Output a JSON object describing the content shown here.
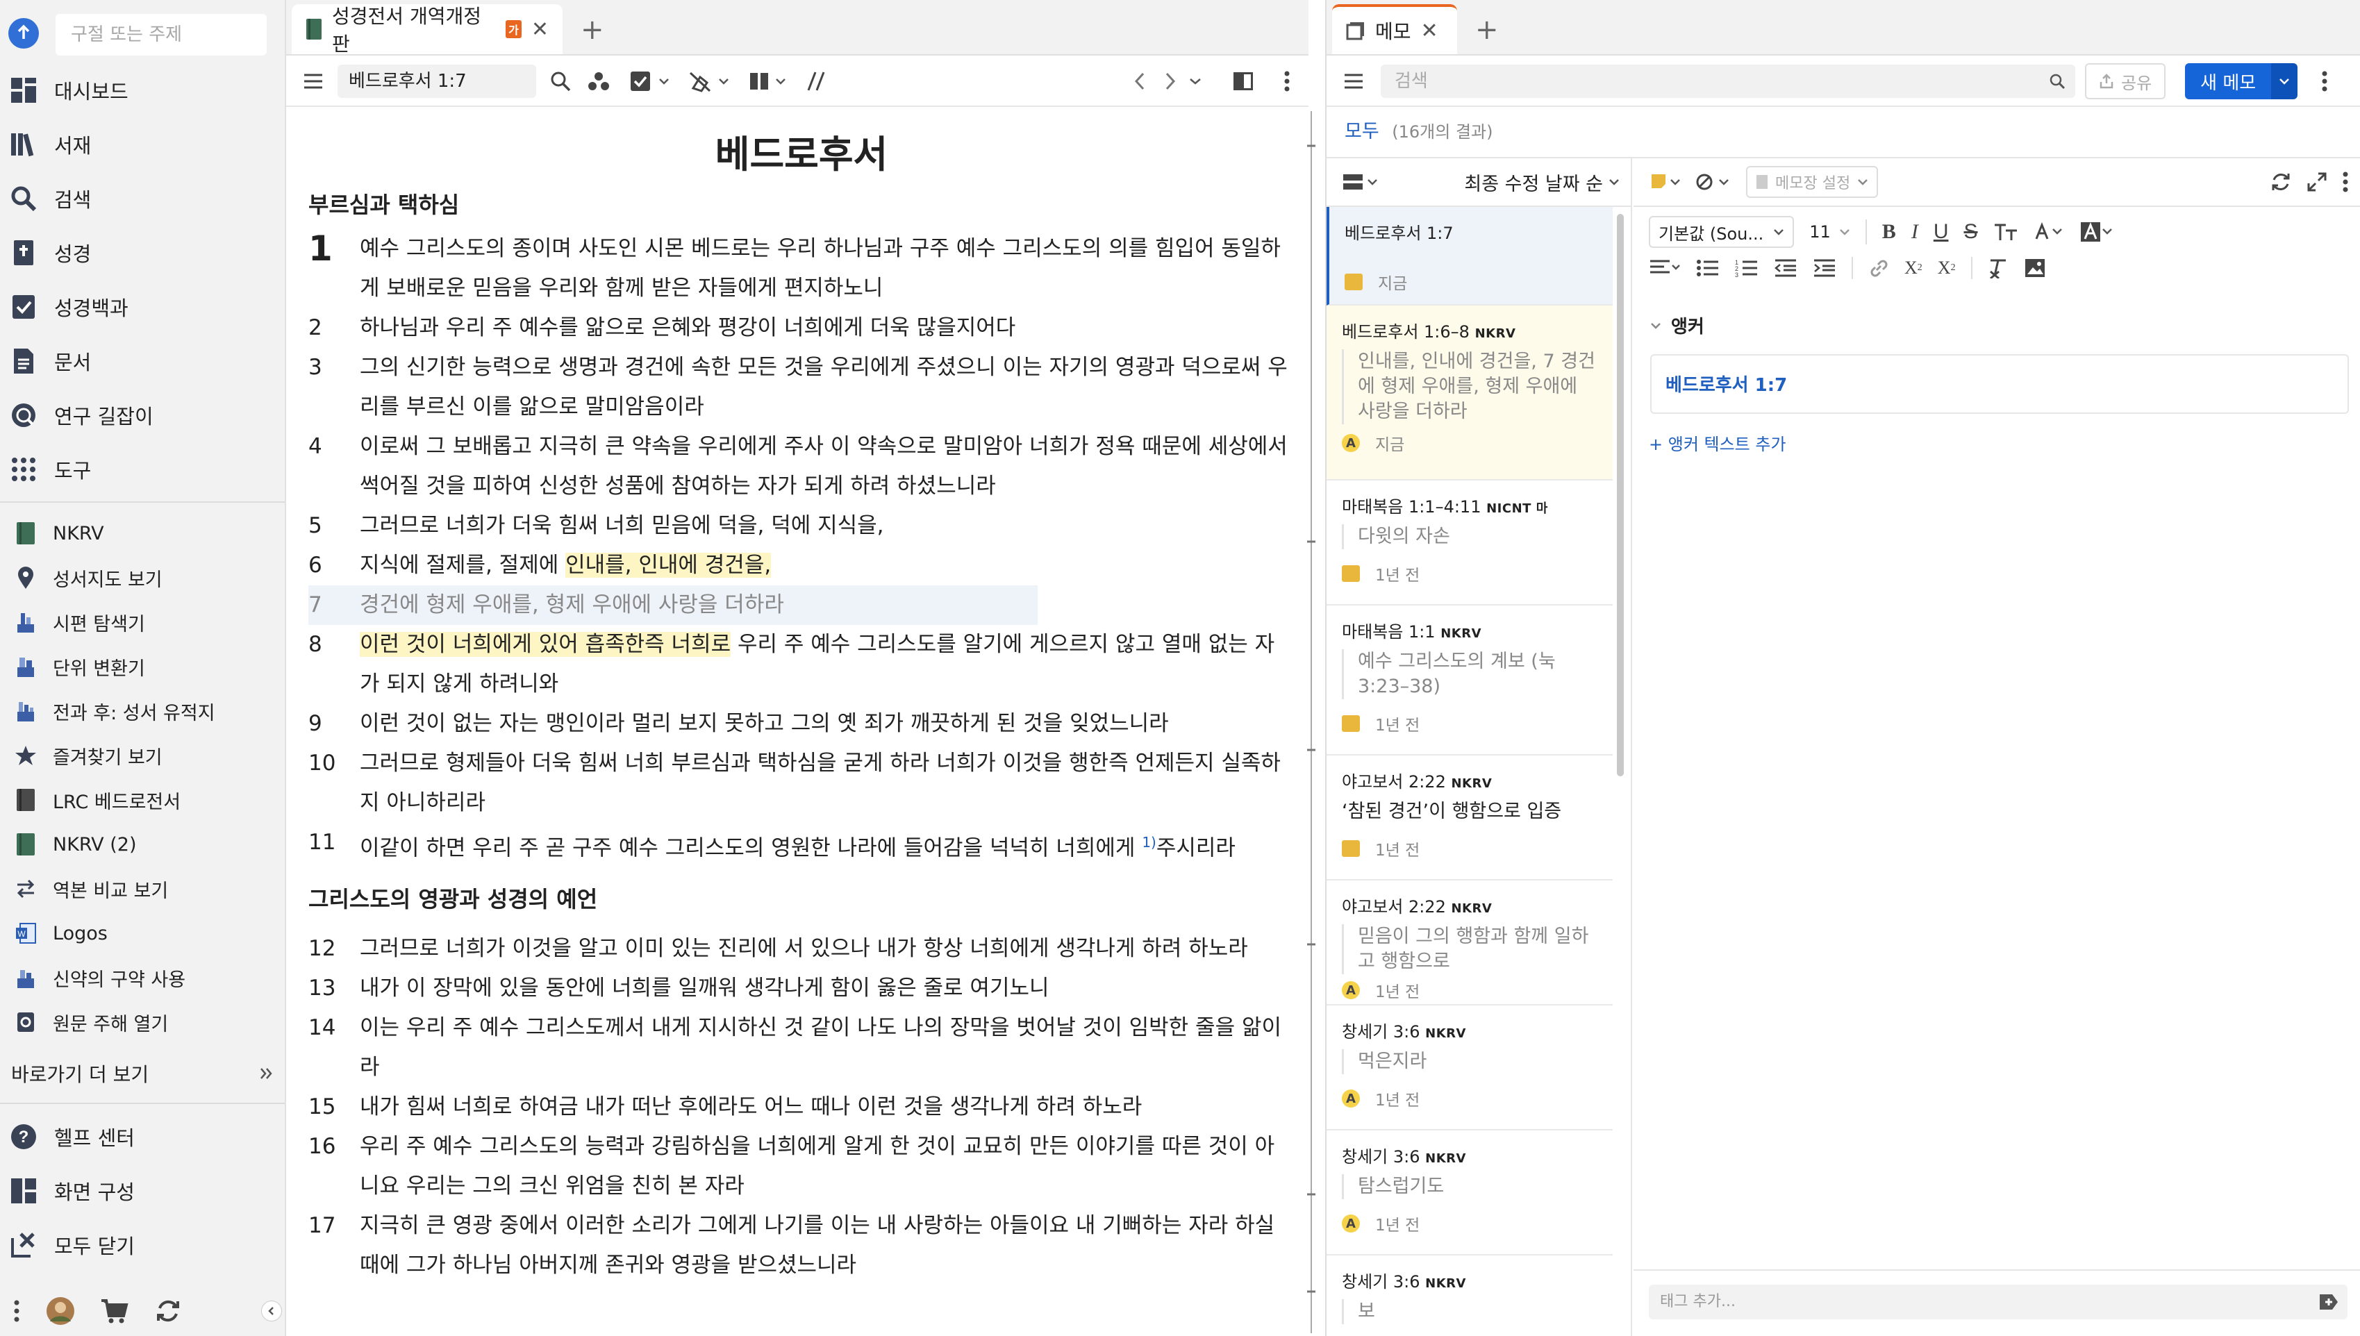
{
  "sidebar": {
    "search_placeholder": "구절 또는 주제",
    "main_items": [
      {
        "label": "대시보드",
        "icon": "dashboard-icon"
      },
      {
        "label": "서재",
        "icon": "library-icon"
      },
      {
        "label": "검색",
        "icon": "search-icon"
      },
      {
        "label": "성경",
        "icon": "bible-icon"
      },
      {
        "label": "성경백과",
        "icon": "factbook-icon"
      },
      {
        "label": "문서",
        "icon": "document-icon"
      },
      {
        "label": "연구 길잡이",
        "icon": "guide-icon"
      },
      {
        "label": "도구",
        "icon": "tools-icon"
      }
    ],
    "shortcuts": [
      {
        "label": "NKRV",
        "icon": "book-icon"
      },
      {
        "label": "성서지도 보기",
        "icon": "map-pin-icon"
      },
      {
        "label": "시편 탐색기",
        "icon": "psalm-icon"
      },
      {
        "label": "단위 변환기",
        "icon": "converter-icon"
      },
      {
        "label": "전과 후: 성서 유적지",
        "icon": "before-after-icon"
      },
      {
        "label": "즐겨찾기 보기",
        "icon": "star-icon"
      },
      {
        "label": "LRC 베드로전서",
        "icon": "book-icon"
      },
      {
        "label": "NKRV (2)",
        "icon": "book-icon"
      },
      {
        "label": "역본 비교 보기",
        "icon": "compare-icon"
      },
      {
        "label": "Logos",
        "icon": "word-icon"
      },
      {
        "label": "신약의 구약 사용",
        "icon": "ot-in-nt-icon"
      },
      {
        "label": "원문 주해 열기",
        "icon": "exegetical-icon"
      }
    ],
    "more_label": "바로가기 더 보기",
    "bottom_items": [
      {
        "label": "헬프 센터",
        "icon": "help-icon"
      },
      {
        "label": "화면 구성",
        "icon": "layout-icon"
      },
      {
        "label": "모두 닫기",
        "icon": "close-all-icon"
      }
    ]
  },
  "bible": {
    "tab_title": "성경전서 개역개정판",
    "tab_badge": "가",
    "reference": "베드로후서 1:7",
    "book_title": "베드로후서",
    "sections": [
      {
        "heading": "부르심과 택하심",
        "verses": [
          {
            "num": "1",
            "text": "예수 그리스도의 종이며 사도인 시몬 베드로는 우리 하나님과 구주 예수 그리스도의 의를 힘입어 동일하게 보배로운 믿음을 우리와 함께 받은 자들에게 편지하노니"
          },
          {
            "num": "2",
            "text": "하나님과 우리 주 예수를 앎으로 은혜와 평강이 너희에게 더욱 많을지어다"
          },
          {
            "num": "3",
            "text": "그의 신기한 능력으로 생명과 경건에 속한 모든 것을 우리에게 주셨으니 이는 자기의 영광과 덕으로써 우리를 부르신 이를 앎으로 말미암음이라"
          },
          {
            "num": "4",
            "text": "이로써 그 보배롭고 지극히 큰 약속을 우리에게 주사 이 약속으로 말미암아 너희가 정욕 때문에 세상에서 썩어질 것을 피하여 신성한 성품에 참여하는 자가 되게 하려 하셨느니라"
          },
          {
            "num": "5",
            "text": "그러므로 너희가 더욱 힘써 너희 믿음에 덕을, 덕에 지식을,"
          },
          {
            "num": "6",
            "pre": "지식에 절제를, 절제에 ",
            "hl": "인내를, 인내에 경건을,"
          },
          {
            "num": "7",
            "text": "경건에 형제 우애를, 형제 우애에 사랑을 더하라"
          },
          {
            "num": "8",
            "hl": "이런 것이 너희에게 있어 흡족한즉 너희로",
            "post": " 우리 주 예수 그리스도를 알기에 게으르지 않고 열매 없는 자가 되지 않게 하려니와"
          },
          {
            "num": "9",
            "text": "이런 것이 없는 자는 맹인이라 멀리 보지 못하고 그의 옛 죄가 깨끗하게 된 것을 잊었느니라"
          },
          {
            "num": "10",
            "text": "그러므로 형제들아 더욱 힘써 너희 부르심과 택하심을 굳게 하라 너희가 이것을 행한즉 언제든지 실족하지 아니하리라"
          },
          {
            "num": "11",
            "pre": "이같이 하면 우리 주 곧 구주 예수 그리스도의 영원한 나라에 들어감을 넉넉히 너희에게 ",
            "fn": "1)",
            "post": "주시리라"
          }
        ]
      },
      {
        "heading": "그리스도의 영광과 성경의 예언",
        "verses": [
          {
            "num": "12",
            "text": "그러므로 너희가 이것을 알고 이미 있는 진리에 서 있으나 내가 항상 너희에게 생각나게 하려 하노라"
          },
          {
            "num": "13",
            "text": "내가 이 장막에 있을 동안에 너희를 일깨워 생각나게 함이 옳은 줄로 여기노니"
          },
          {
            "num": "14",
            "text": "이는 우리 주 예수 그리스도께서 내게 지시하신 것 같이 나도 나의 장막을 벗어날 것이 임박한 줄을 앎이라"
          },
          {
            "num": "15",
            "text": "내가 힘써 너희로 하여금 내가 떠난 후에라도 어느 때나 이런 것을 생각나게 하려 하노라"
          },
          {
            "num": "16",
            "text": "우리 주 예수 그리스도의 능력과 강림하심을 너희에게 알게 한 것이 교묘히 만든 이야기를 따른 것이 아니요 우리는 그의 크신 위엄을 친히 본 자라"
          },
          {
            "num": "17",
            "text": "지극히 큰 영광 중에서 이러한 소리가 그에게 나기를 이는 내 사랑하는 아들이요 내 기뻐하는 자라 하실 때에 그가 하나님 아버지께 존귀와 영광을 받으셨느니라"
          }
        ]
      }
    ]
  },
  "notes": {
    "tab_title": "메모",
    "search_placeholder": "검색",
    "share_label": "공유",
    "new_note_label": "새 메모",
    "filter_all": "모두",
    "result_count": "(16개의 결과)",
    "sort_label": "최종 수정 날짜 순",
    "notebook_placeholder": "메모장 설정",
    "items": [
      {
        "ref": "베드로후서 1:7",
        "version": "",
        "preview": "",
        "time": "지금",
        "badge": "note"
      },
      {
        "ref": "베드로후서 1:6–8",
        "version": "NKRV",
        "preview": "인내를, 인내에 경건을, 7 경건에 형제 우애를, 형제 우애에 사랑을 더하라",
        "time": "지금",
        "badge": "A"
      },
      {
        "ref": "마태복음 1:1–4:11",
        "version": "NICNT 마",
        "preview": "다윗의 자손",
        "time": "1년 전",
        "badge": "note"
      },
      {
        "ref": "마태복음 1:1",
        "version": "NKRV",
        "preview": "예수 그리스도의 계보 (눅 3:23–38)",
        "time": "1년 전",
        "badge": "note"
      },
      {
        "ref": "야고보서 2:22",
        "version": "NKRV",
        "preview": "‘참된 경건’이 행함으로 입증",
        "time": "1년 전",
        "badge": "note",
        "dark": true
      },
      {
        "ref": "야고보서 2:22",
        "version": "NKRV",
        "preview": "믿음이 그의 행함과 함께 일하고 행함으로",
        "time": "1년 전",
        "badge": "A"
      },
      {
        "ref": "창세기 3:6",
        "version": "NKRV",
        "preview": "먹은지라",
        "time": "1년 전",
        "badge": "A"
      },
      {
        "ref": "창세기 3:6",
        "version": "NKRV",
        "preview": "탐스럽기도",
        "time": "1년 전",
        "badge": "A"
      },
      {
        "ref": "창세기 3:6",
        "version": "NKRV",
        "preview": "보",
        "time": "",
        "badge": ""
      }
    ],
    "editor": {
      "font_label": "기본값 (Sou...",
      "font_size": "11",
      "anchor_heading": "앵커",
      "anchor_ref": "베드로후서 1:7",
      "add_anchor_text": "+ 앵커 텍스트 추가",
      "tag_placeholder": "태그 추가..."
    }
  },
  "colors": {
    "accent": "#1565d8",
    "highlight": "#fdf5c4",
    "tab_accent": "#e8661f"
  }
}
